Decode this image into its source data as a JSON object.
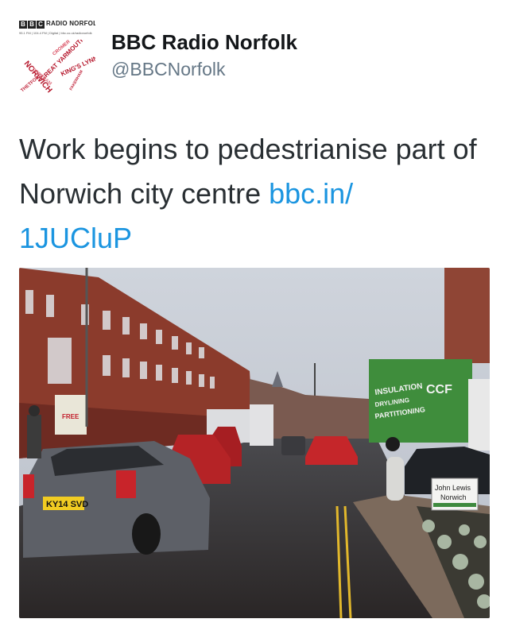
{
  "tweet": {
    "author": {
      "display_name": "BBC Radio Norfolk",
      "handle": "@BBCNorfolk",
      "avatar": {
        "brand_blocks": [
          "B",
          "B",
          "C"
        ],
        "station_name": "RADIO NORFOLK",
        "frequency_line": "95.1 FM | 104.4 FM | Digital | bbc.co.uk/radionorfolk",
        "place_names": [
          "NORWICH",
          "GREAT YARMOUTH",
          "KING'S LYNN",
          "CROMER",
          "THETFORD",
          "DEREHAM",
          "FAKENHAM"
        ]
      }
    },
    "text_before_link": "Work begins to pedestrianise part of Norwich city centre ",
    "link_line1": "bbc.in/",
    "link_line2": "1JUCluP",
    "media": {
      "type": "photo",
      "signs": {
        "insulation": "INSULATION",
        "dry_lining": "DRYLINING",
        "partitioning": "PARTITIONING",
        "ccf": "CCF",
        "john_lewis_line1": "John Lewis",
        "john_lewis_line2": "Norwich",
        "plate": "KY14 SVD",
        "shop_sign": "FREE"
      }
    },
    "colors": {
      "link": "#1b95e0",
      "text": "#292f33",
      "handle": "#657786",
      "brand_red": "#b5162b"
    }
  }
}
